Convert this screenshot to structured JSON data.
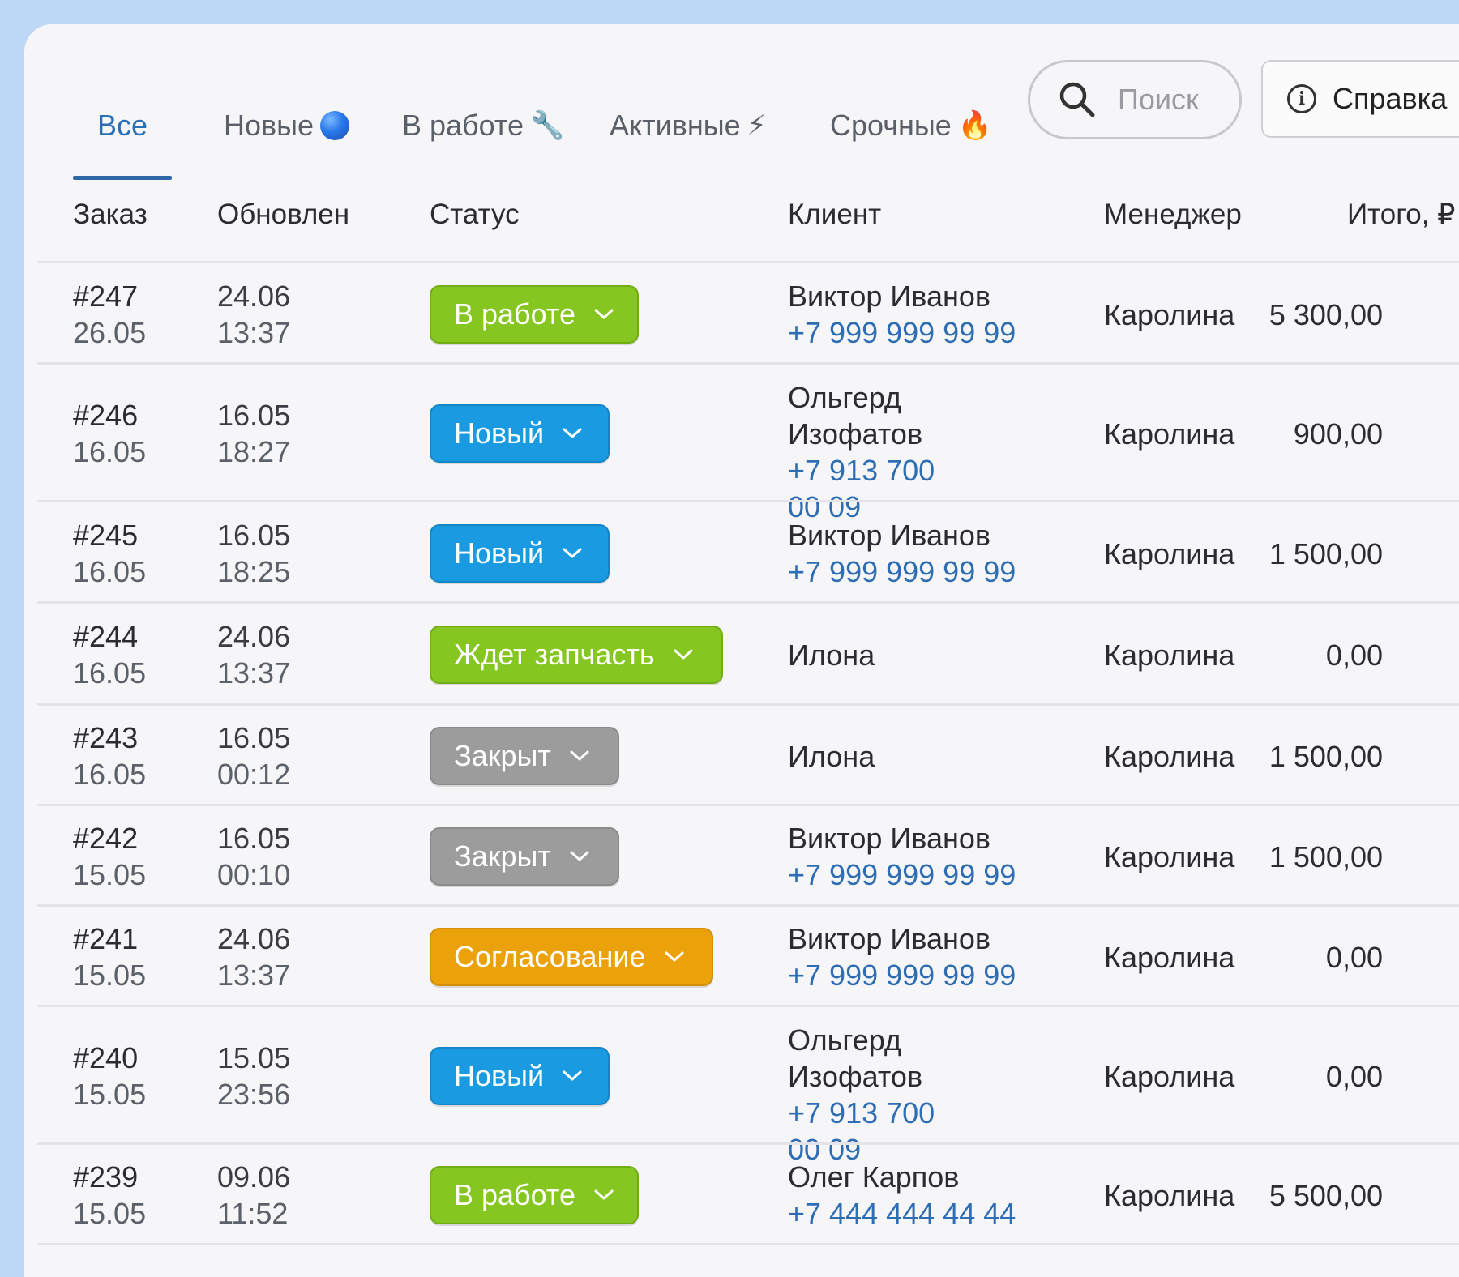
{
  "tabs": [
    {
      "label": "Все",
      "emoji": ""
    },
    {
      "label": "Новые",
      "emoji": ""
    },
    {
      "label": "В работе",
      "emoji": "🔧"
    },
    {
      "label": "Активные",
      "emoji": "⚡"
    },
    {
      "label": "Срочные",
      "emoji": "🔥"
    }
  ],
  "search": {
    "placeholder": "Поиск"
  },
  "help": {
    "label": "Справка"
  },
  "columns": [
    "Заказ",
    "Обновлен",
    "Статус",
    "Клиент",
    "Менеджер",
    "Итого, ₽"
  ],
  "rows": [
    {
      "order": "#247",
      "created": "26.05",
      "upd_date": "24.06",
      "upd_time": "13:37",
      "status": "В работе",
      "status_color": "green",
      "client_name": "Виктор Иванов",
      "client_phone": "+7 999 999 99 99",
      "manager": "Каролина",
      "total": "5 300,00"
    },
    {
      "order": "#246",
      "created": "16.05",
      "upd_date": "16.05",
      "upd_time": "18:27",
      "status": "Новый",
      "status_color": "blue",
      "client_name": "Ольгерд Изофатов",
      "client_phone": "+7 913 700 00 09",
      "manager": "Каролина",
      "total": "900,00"
    },
    {
      "order": "#245",
      "created": "16.05",
      "upd_date": "16.05",
      "upd_time": "18:25",
      "status": "Новый",
      "status_color": "blue",
      "client_name": "Виктор Иванов",
      "client_phone": "+7 999 999 99 99",
      "manager": "Каролина",
      "total": "1 500,00"
    },
    {
      "order": "#244",
      "created": "16.05",
      "upd_date": "24.06",
      "upd_time": "13:37",
      "status": "Ждет запчасть",
      "status_color": "green",
      "client_name": "Илона",
      "client_phone": "",
      "manager": "Каролина",
      "total": "0,00"
    },
    {
      "order": "#243",
      "created": "16.05",
      "upd_date": "16.05",
      "upd_time": "00:12",
      "status": "Закрыт",
      "status_color": "gray",
      "client_name": "Илона",
      "client_phone": "",
      "manager": "Каролина",
      "total": "1 500,00"
    },
    {
      "order": "#242",
      "created": "15.05",
      "upd_date": "16.05",
      "upd_time": "00:10",
      "status": "Закрыт",
      "status_color": "gray",
      "client_name": "Виктор Иванов",
      "client_phone": "+7 999 999 99 99",
      "manager": "Каролина",
      "total": "1 500,00"
    },
    {
      "order": "#241",
      "created": "15.05",
      "upd_date": "24.06",
      "upd_time": "13:37",
      "status": "Согласование",
      "status_color": "orange",
      "client_name": "Виктор Иванов",
      "client_phone": "+7 999 999 99 99",
      "manager": "Каролина",
      "total": "0,00"
    },
    {
      "order": "#240",
      "created": "15.05",
      "upd_date": "15.05",
      "upd_time": "23:56",
      "status": "Новый",
      "status_color": "blue",
      "client_name": "Ольгерд Изофатов",
      "client_phone": "+7 913 700 00 09",
      "manager": "Каролина",
      "total": "0,00"
    },
    {
      "order": "#239",
      "created": "15.05",
      "upd_date": "09.06",
      "upd_time": "11:52",
      "status": "В работе",
      "status_color": "green",
      "client_name": "Олег Карпов",
      "client_phone": "+7 444 444 44 44",
      "manager": "Каролина",
      "total": "5 500,00"
    }
  ]
}
